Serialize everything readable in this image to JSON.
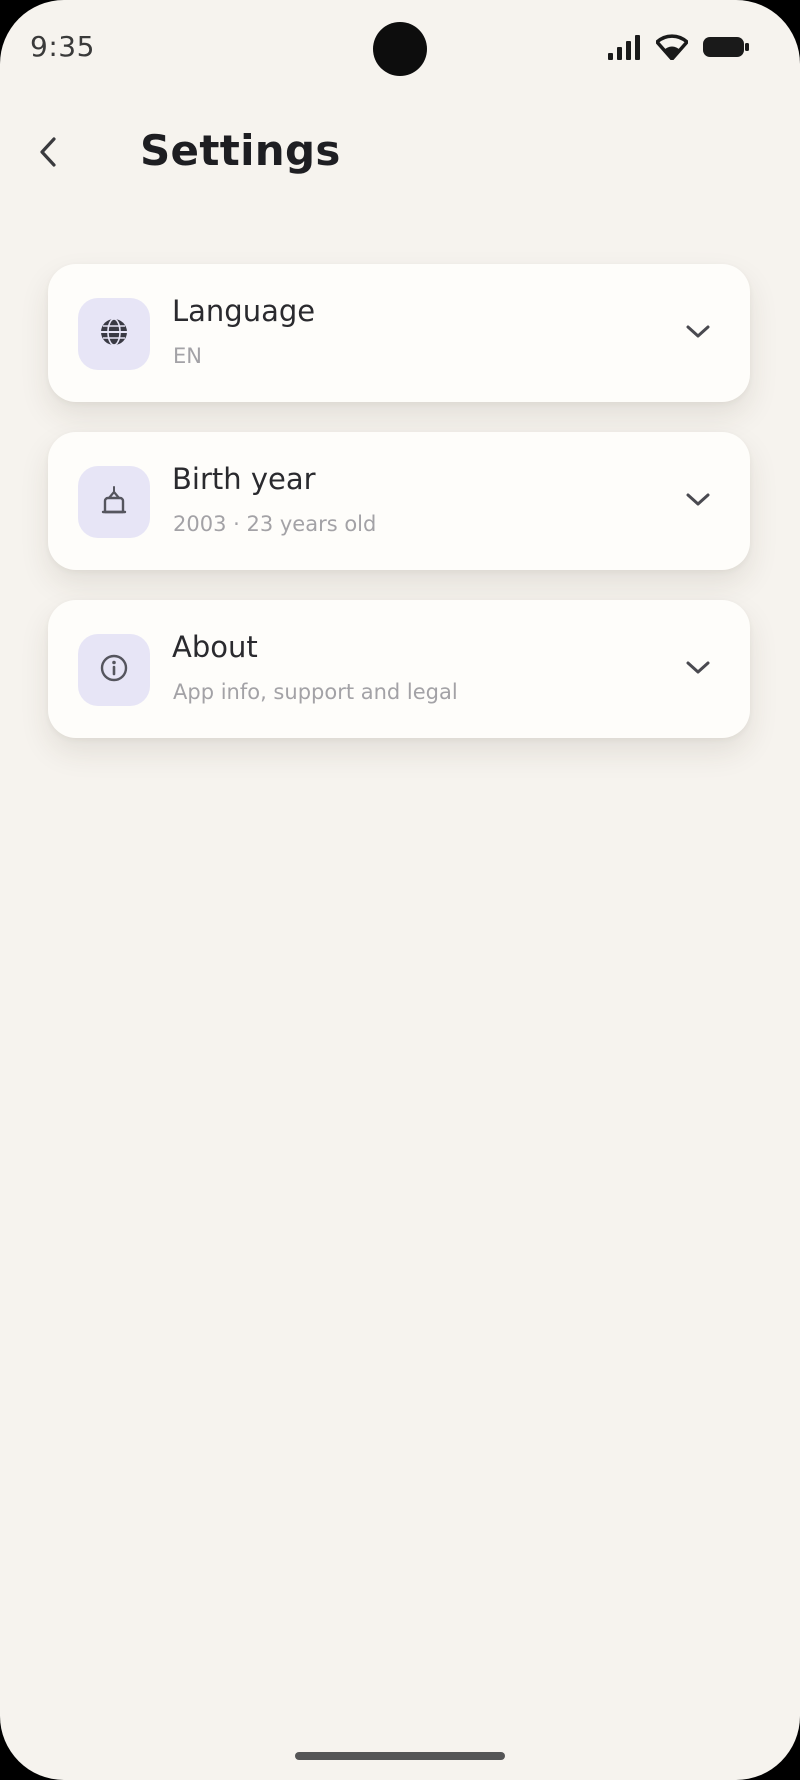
{
  "status_bar": {
    "time": "9:35",
    "icons": [
      "signal-icon",
      "wifi-icon",
      "battery-icon"
    ]
  },
  "header": {
    "back_icon": "chevron-left-icon",
    "title": "Settings"
  },
  "settings": [
    {
      "id": "language",
      "icon": "globe-icon",
      "title": "Language",
      "subtitle": "EN"
    },
    {
      "id": "birth-year",
      "icon": "cake-icon",
      "title": "Birth year",
      "subtitle": "2003 · 23 years old"
    },
    {
      "id": "about",
      "icon": "info-icon",
      "title": "About",
      "subtitle": "App info, support and legal"
    }
  ],
  "colors": {
    "background": "#f6f3ee",
    "card": "#fefdfa",
    "icon_tile": "#e7e5f6",
    "title_text": "#1e1e22",
    "subtitle_text": "#a3a2a6"
  }
}
